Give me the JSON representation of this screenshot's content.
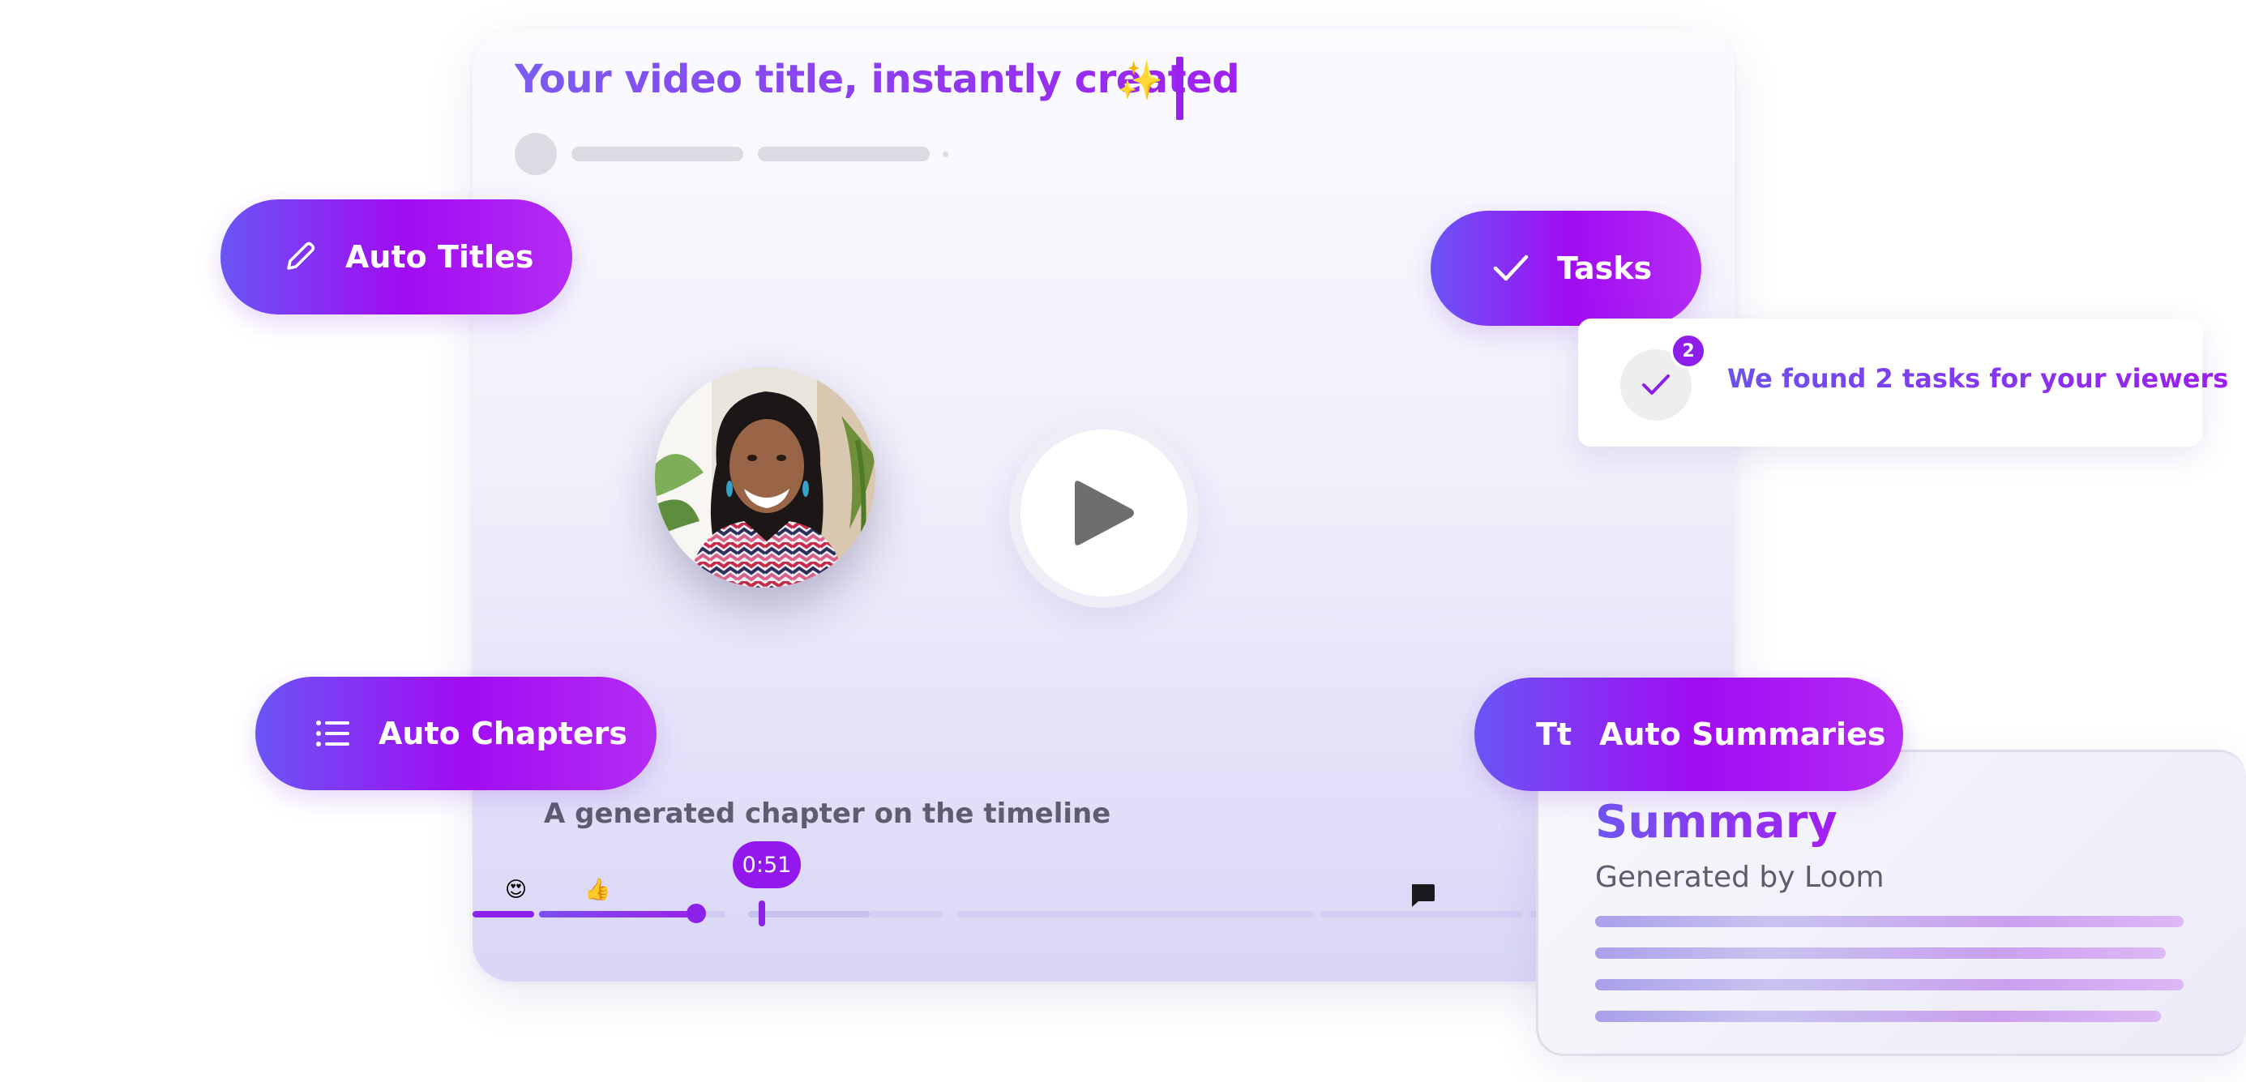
{
  "video": {
    "title": "Your video title, instantly created",
    "title_emoji": "✨",
    "play_icon": "play-icon",
    "chapter_label": "A generated chapter on the timeline",
    "timestamp": "0:51",
    "reactions": [
      "😍",
      "👍"
    ],
    "comment_icon": "comment-icon"
  },
  "features": {
    "auto_titles": {
      "label": "Auto Titles",
      "icon": "pencil-icon"
    },
    "tasks": {
      "label": "Tasks",
      "icon": "check-icon"
    },
    "auto_chapters": {
      "label": "Auto Chapters",
      "icon": "list-icon"
    },
    "auto_summaries": {
      "label": "Auto Summaries",
      "icon_text": "Tt"
    }
  },
  "tasks_card": {
    "badge_count": "2",
    "message": "We found 2 tasks for your viewers"
  },
  "summary_card": {
    "title": "Summary",
    "subtitle": "Generated by Loom"
  },
  "colors": {
    "accent_purple": "#9318ee",
    "gradient_start": "#6a55f5",
    "gradient_end": "#b42cf4"
  }
}
